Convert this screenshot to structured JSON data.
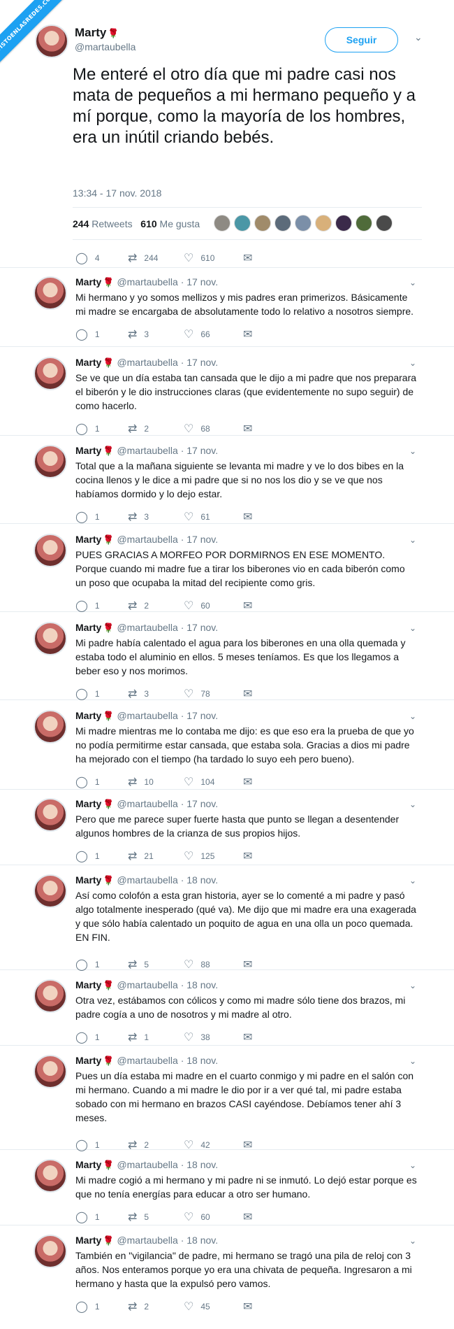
{
  "watermark": "VISTOENLASREDES.COM",
  "author": {
    "name": "Marty",
    "handle": "@martaubella",
    "rose": "🌹"
  },
  "follow_label": "Seguir",
  "chevron": "⌄",
  "main": {
    "text": "Me enteré el otro día que mi padre casi nos mata de pequeños a mi hermano pequeño y a mí porque, como la mayoría de los hombres, era un inútil criando bebés.",
    "time": "13:34 - 17 nov. 2018",
    "retweets": "244",
    "retweets_label": "Retweets",
    "likes": "610",
    "likes_label": "Me gusta",
    "replies": "4",
    "face_colors": [
      "#8e8a83",
      "#4b97a6",
      "#a08b6a",
      "#5c6b7a",
      "#7b8fa8",
      "#d8b07a",
      "#3b2a4a",
      "#4f6b3a",
      "#4a4a4a"
    ]
  },
  "icons": {
    "reply": "reply-icon",
    "retweet": "retweet-icon",
    "like": "like-icon",
    "message": "message-icon"
  },
  "glyphs": {
    "reply": "◯",
    "retweet": "⇄",
    "like": "♡",
    "message": "✉"
  },
  "replies": [
    {
      "date": "· 17 nov.",
      "text": "Mi hermano y yo somos mellizos y mis padres eran primerizos. Básicamente mi madre se encargaba de absolutamente todo lo relativo a nosotros siempre.",
      "r": "1",
      "rt": "3",
      "l": "66"
    },
    {
      "date": "· 17 nov.",
      "text": "Se ve que un día estaba tan cansada que le dijo a mi padre que nos preparara el biberón y le dio instrucciones claras (que evidentemente no supo seguir) de como hacerlo.",
      "r": "1",
      "rt": "2",
      "l": "68"
    },
    {
      "date": "· 17 nov.",
      "text": "Total que a la mañana siguiente se levanta mi madre y ve lo dos bibes en la cocina llenos y le dice a mi padre que si no nos los dio y se ve que nos habíamos dormido y lo dejo estar.",
      "r": "1",
      "rt": "3",
      "l": "61"
    },
    {
      "date": "· 17 nov.",
      "text": "PUES GRACIAS A MORFEO POR DORMIRNOS EN ESE MOMENTO. Porque cuando mi madre fue a tirar los biberones vio en cada biberón como un poso que ocupaba la mitad del recipiente como gris.",
      "r": "1",
      "rt": "2",
      "l": "60"
    },
    {
      "date": "· 17 nov.",
      "text": "Mi padre había calentado el agua para los biberones en una olla quemada y estaba todo el aluminio en ellos. 5 meses teníamos. Es que los llegamos a beber eso y nos morimos.",
      "r": "1",
      "rt": "3",
      "l": "78"
    },
    {
      "date": "· 17 nov.",
      "text": "Mi madre mientras me lo contaba me dijo: es que eso era la prueba de que yo no podía permitirme estar cansada, que estaba sola. Gracias a dios mi padre ha mejorado con el tiempo (ha tardado lo suyo eeh pero bueno).",
      "r": "1",
      "rt": "10",
      "l": "104"
    },
    {
      "date": "· 17 nov.",
      "text": "Pero que me parece super fuerte hasta que punto se llegan a desentender algunos hombres de la crianza de sus propios hijos.",
      "r": "1",
      "rt": "21",
      "l": "125"
    },
    {
      "date": "· 18 nov.",
      "text": "Así como colofón a esta gran historia, ayer se lo comenté a mi padre y pasó algo totalmente inesperado (qué va). Me dijo que mi madre era una exagerada y que sólo había calentado un poquito de agua en una olla un poco quemada. EN FIN.",
      "r": "1",
      "rt": "5",
      "l": "88"
    },
    {
      "date": "· 18 nov.",
      "text": "Otra vez, estábamos con cólicos y como mi madre sólo tiene dos brazos, mi padre cogía a uno de nosotros y mi madre al otro.",
      "r": "1",
      "rt": "1",
      "l": "38"
    },
    {
      "date": "· 18 nov.",
      "text": "Pues un día estaba mi madre en el cuarto conmigo y mi padre en el salón con mi hermano. Cuando a mi madre le dio por ir a ver qué tal, mi padre estaba sobado con mi hermano en brazos CASI cayéndose. Debíamos tener ahí 3 meses.",
      "r": "1",
      "rt": "2",
      "l": "42"
    },
    {
      "date": "· 18 nov.",
      "text": "Mi madre cogió a mi hermano y mi padre ni se inmutó. Lo dejó estar porque es que no tenía energías para educar a otro ser humano.",
      "r": "1",
      "rt": "5",
      "l": "60"
    },
    {
      "date": "· 18 nov.",
      "text": "También en \"vigilancia\" de padre, mi hermano se tragó una pila de reloj con 3 años. Nos enteramos porque yo era una chivata de pequeña. Ingresaron a mi hermano y hasta que la expulsó pero vamos.",
      "r": "1",
      "rt": "2",
      "l": "45"
    }
  ]
}
